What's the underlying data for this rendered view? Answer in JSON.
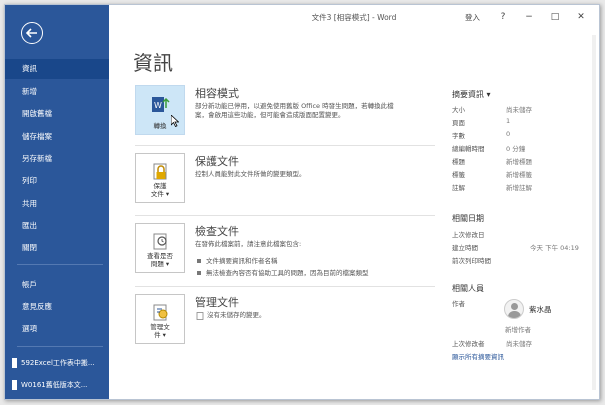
{
  "window": {
    "title": "文件3 [相容模式] - Word",
    "login": "登入",
    "minimize": "−",
    "restore": "□",
    "close": "✕",
    "help": "?"
  },
  "sidebar": {
    "items": [
      {
        "label": "資訊"
      },
      {
        "label": "新增"
      },
      {
        "label": "開啟舊檔"
      },
      {
        "label": "儲存檔案"
      },
      {
        "label": "另存新檔"
      },
      {
        "label": "列印"
      },
      {
        "label": "共用"
      },
      {
        "label": "匯出"
      },
      {
        "label": "關閉"
      },
      {
        "label": "帳戶"
      },
      {
        "label": "意見反應"
      },
      {
        "label": "選項"
      }
    ],
    "recent": [
      {
        "label": "592Excel工作表中搬..."
      },
      {
        "label": "W0161舊低版本文..."
      }
    ]
  },
  "page": {
    "title": "資訊"
  },
  "compat": {
    "tile_label": "轉換",
    "heading": "相容模式",
    "desc": "部分新功能已停用，以避免使用舊版 Office 時發生問題，若轉換此檔案，會啟用這些功能，但可能會造成版面配置變更。"
  },
  "protect": {
    "tile_label1": "保護",
    "tile_label2": "文件 ▾",
    "heading": "保護文件",
    "desc": "控制人員能對此文件所做的變更類型。"
  },
  "inspect": {
    "tile_label1": "查看是否",
    "tile_label2": "問題 ▾",
    "heading": "檢查文件",
    "desc": "在發佈此檔案前，請注意此檔案包含:",
    "bullets": [
      "文件摘要資訊和作者名稱",
      "無法檢查內容否有協助工具的問題，因為目前的檔案類型"
    ]
  },
  "manage": {
    "tile_label1": "管理文",
    "tile_label2": "件 ▾",
    "heading": "管理文件",
    "desc": "沒有未儲存的變更。"
  },
  "properties": {
    "heading": "摘要資訊 ▾",
    "rows": [
      {
        "k": "大小",
        "v": "尚未儲存"
      },
      {
        "k": "頁面",
        "v": "1"
      },
      {
        "k": "字數",
        "v": "0"
      },
      {
        "k": "總編輯時間",
        "v": "0 分鐘"
      },
      {
        "k": "標題",
        "v": "新增標題"
      },
      {
        "k": "標籤",
        "v": "新增標籤"
      },
      {
        "k": "註解",
        "v": "新增註解"
      }
    ],
    "dates_heading": "相關日期",
    "dates": [
      {
        "k": "上次修改日",
        "v": ""
      },
      {
        "k": "建立時間",
        "v": "今天 下午 04:19"
      },
      {
        "k": "前次列印時間",
        "v": ""
      }
    ],
    "people_heading": "相關人員",
    "author_label": "作者",
    "author_name": "紫水晶",
    "add_author": "新增作者",
    "last_modified_by": "上次修改者",
    "last_modified_value": "尚未儲存",
    "show_all": "顯示所有摘要資訊"
  }
}
